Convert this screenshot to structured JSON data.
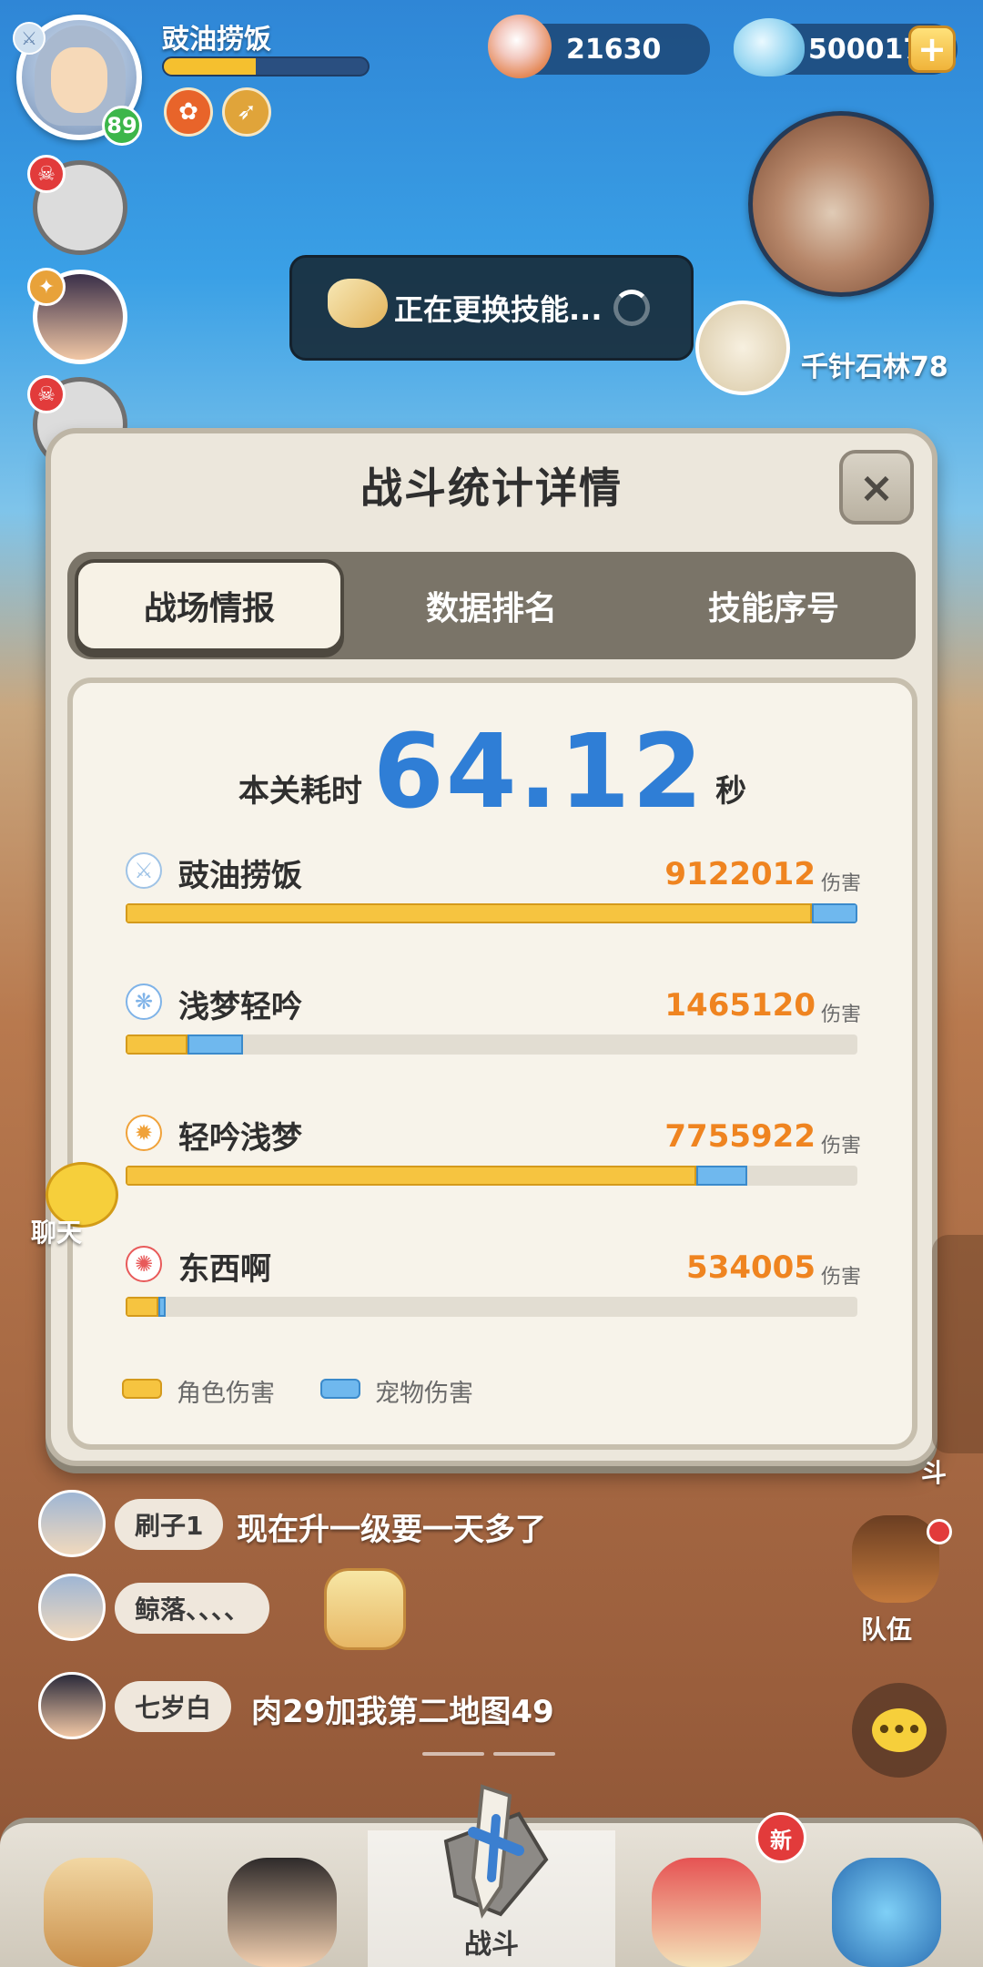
{
  "player": {
    "name": "豉油捞饭",
    "level": "89",
    "xp_fraction": 0.45
  },
  "currencies": {
    "pearls": "21630",
    "gems": "500017",
    "add_symbol": "+"
  },
  "map": {
    "location": "千针石林78"
  },
  "toast": {
    "text": "正在更换技能..."
  },
  "panel": {
    "title": "战斗统计详情",
    "close_symbol": "×",
    "tabs": [
      "战场情报",
      "数据排名",
      "技能序号"
    ],
    "active_tab": 0,
    "time": {
      "label": "本关耗时",
      "value": "64.12",
      "unit": "秒"
    },
    "damage_unit": "伤害",
    "legend": {
      "character": "角色伤害",
      "pet": "宠物伤害"
    },
    "rows": [
      {
        "name": "豉油捞饭",
        "damage": "9122012",
        "char_fraction": 0.938,
        "pet_fraction": 0.062,
        "icon": "sword-icon",
        "color": "#9fc3e6"
      },
      {
        "name": "浅梦轻吟",
        "damage": "1465120",
        "char_fraction": 0.085,
        "pet_fraction": 0.075,
        "icon": "wind-icon",
        "color": "#7fb3e8"
      },
      {
        "name": "轻吟浅梦",
        "damage": "7755922",
        "char_fraction": 0.78,
        "pet_fraction": 0.07,
        "icon": "flame-icon",
        "color": "#f0a23a"
      },
      {
        "name": "东西啊",
        "damage": "534005",
        "char_fraction": 0.045,
        "pet_fraction": 0.01,
        "icon": "swirl-icon",
        "color": "#e85a5a"
      }
    ]
  },
  "chat": {
    "side_label": "聊天",
    "messages": [
      {
        "name": "刷子1",
        "text": "现在升一级要一天多了"
      },
      {
        "name": "鲸落、、、、",
        "text": ""
      },
      {
        "name": "七岁白",
        "text": "肉29加我第二地图49"
      }
    ]
  },
  "team": {
    "label": "队伍"
  },
  "side_partial_label": "斗",
  "bottom_nav": {
    "items": [
      "",
      "",
      "战斗",
      "",
      ""
    ],
    "active_index": 2,
    "new_badge": "新"
  },
  "colors": {
    "accent_blue": "#2f7ed6",
    "damage_orange": "#ef8420",
    "char_bar": "#f6c440",
    "pet_bar": "#6fb8ee"
  }
}
